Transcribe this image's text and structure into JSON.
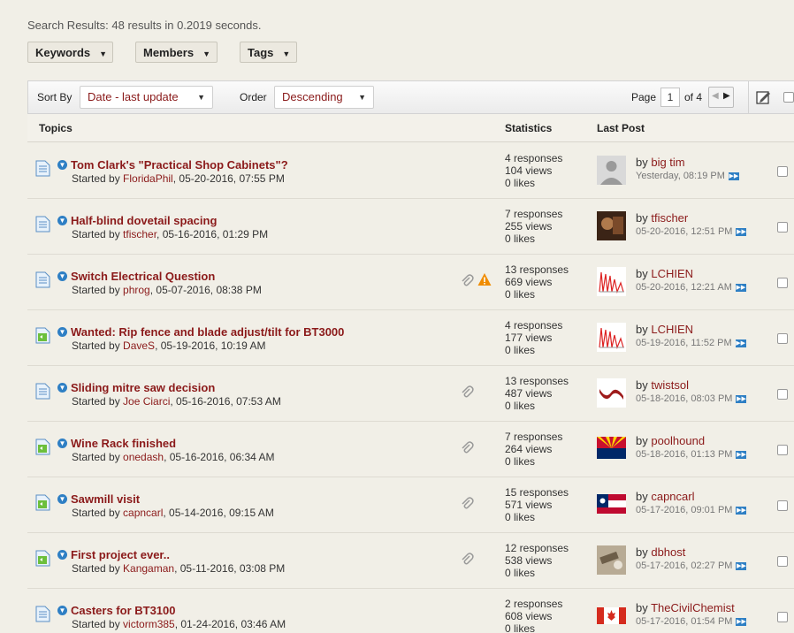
{
  "summary": "Search Results: 48 results in 0.2019 seconds.",
  "filters": [
    {
      "label": "Keywords"
    },
    {
      "label": "Members"
    },
    {
      "label": "Tags"
    }
  ],
  "toolbar": {
    "sort_label": "Sort By",
    "sort_value": "Date - last update",
    "order_label": "Order",
    "order_value": "Descending",
    "page_label": "Page",
    "page_value": "1",
    "page_of": "of 4"
  },
  "columns": {
    "topics": "Topics",
    "statistics": "Statistics",
    "last_post": "Last Post"
  },
  "topics": [
    {
      "title": "Tom Clark's \"Practical Shop Cabinets\"?",
      "started_prefix": "Started by ",
      "user": "FloridaPhil",
      "date": ", 05-20-2016, 07:55 PM",
      "responses": "4 responses",
      "views": "104 views",
      "likes": "0 likes",
      "lp_by": "by ",
      "lp_user": "big tim",
      "lp_date": "Yesterday, 08:19 PM",
      "icon": "doc-icon",
      "attachment": false,
      "warning": false,
      "avatar": "default-avatar"
    },
    {
      "title": "Half-blind dovetail spacing",
      "started_prefix": "Started by ",
      "user": "tfischer",
      "date": ", 05-16-2016, 01:29 PM",
      "responses": "7 responses",
      "views": "255 views",
      "likes": "0 likes",
      "lp_by": "by ",
      "lp_user": "tfischer",
      "lp_date": "05-20-2016, 12:51 PM",
      "icon": "doc-icon",
      "attachment": false,
      "warning": false,
      "avatar": "photo-dark"
    },
    {
      "title": "Switch Electrical Question",
      "started_prefix": "Started by ",
      "user": "phrog",
      "date": ", 05-07-2016, 08:38 PM",
      "responses": "13 responses",
      "views": "669 views",
      "likes": "0 likes",
      "lp_by": "by ",
      "lp_user": "LCHIEN",
      "lp_date": "05-20-2016, 12:21 AM",
      "icon": "doc-icon",
      "attachment": true,
      "warning": true,
      "avatar": "graph"
    },
    {
      "title": "Wanted: Rip fence and blade adjust/tilt for BT3000",
      "started_prefix": "Started by ",
      "user": "DaveS",
      "date": ", 05-19-2016, 10:19 AM",
      "responses": "4 responses",
      "views": "177 views",
      "likes": "0 likes",
      "lp_by": "by ",
      "lp_user": "LCHIEN",
      "lp_date": "05-19-2016, 11:52 PM",
      "icon": "doc-image-icon",
      "attachment": false,
      "warning": false,
      "avatar": "graph"
    },
    {
      "title": "Sliding mitre saw decision",
      "started_prefix": "Started by ",
      "user": "Joe Ciarci",
      "date": ", 05-16-2016, 07:53 AM",
      "responses": "13 responses",
      "views": "487 views",
      "likes": "0 likes",
      "lp_by": "by ",
      "lp_user": "twistsol",
      "lp_date": "05-18-2016, 08:03 PM",
      "icon": "doc-icon",
      "attachment": true,
      "warning": false,
      "avatar": "logo-red"
    },
    {
      "title": "Wine Rack finished",
      "started_prefix": "Started by ",
      "user": "onedash",
      "date": ", 05-16-2016, 06:34 AM",
      "responses": "7 responses",
      "views": "264 views",
      "likes": "0 likes",
      "lp_by": "by ",
      "lp_user": "poolhound",
      "lp_date": "05-18-2016, 01:13 PM",
      "icon": "doc-image-icon",
      "attachment": true,
      "warning": false,
      "avatar": "arizona-flag"
    },
    {
      "title": "Sawmill visit",
      "started_prefix": "Started by ",
      "user": "capncarl",
      "date": ", 05-14-2016, 09:15 AM",
      "responses": "15 responses",
      "views": "571 views",
      "likes": "0 likes",
      "lp_by": "by ",
      "lp_user": "capncarl",
      "lp_date": "05-17-2016, 09:01 PM",
      "icon": "doc-image-icon",
      "attachment": true,
      "warning": false,
      "avatar": "georgia-flag"
    },
    {
      "title": "First project ever..",
      "started_prefix": "Started by ",
      "user": "Kangaman",
      "date": ", 05-11-2016, 03:08 PM",
      "responses": "12 responses",
      "views": "538 views",
      "likes": "0 likes",
      "lp_by": "by ",
      "lp_user": "dbhost",
      "lp_date": "05-17-2016, 02:27 PM",
      "icon": "doc-image-icon",
      "attachment": true,
      "warning": false,
      "avatar": "photo-tools"
    },
    {
      "title": "Casters for BT3100",
      "started_prefix": "Started by ",
      "user": "victorm385",
      "date": ", 01-24-2016, 03:46 AM",
      "responses": "2 responses",
      "views": "608 views",
      "likes": "0 likes",
      "lp_by": "by ",
      "lp_user": "TheCivilChemist",
      "lp_date": "05-17-2016, 01:54 PM",
      "icon": "doc-icon",
      "attachment": false,
      "warning": false,
      "avatar": "canada-flag"
    }
  ]
}
